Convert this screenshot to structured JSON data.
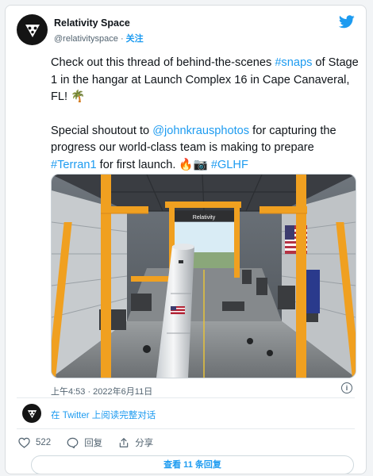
{
  "author": {
    "display_name": "Relativity Space",
    "handle": "@relativityspace",
    "separator": "·",
    "follow_label": "关注"
  },
  "tweet": {
    "para1": {
      "before": "Check out this thread of behind-the-scenes ",
      "hashtag": "#snaps",
      "after": " of Stage 1 in the hangar at Launch Complex 16 in Cape Canaveral, FL! 🌴"
    },
    "para2": {
      "before": "Special shoutout to ",
      "mention": "@johnkrausphotos",
      "middle": " for capturing the progress our world-class team is making to prepare ",
      "hashtag1": "#Terran1",
      "after": " for first launch. 🔥📷 ",
      "hashtag2": "#GLHF"
    }
  },
  "image": {
    "sign_text": "Relativity"
  },
  "timestamp": "上午4:53 · 2022年6月11日",
  "read_on_twitter": "在 Twitter 上阅读完整对话",
  "actions": {
    "like_count": "522",
    "reply_label": "回复",
    "share_label": "分享"
  },
  "view_replies": "查看 11 条回复",
  "colors": {
    "accent": "#1d9bf0",
    "text": "#0f1419",
    "muted": "#536471",
    "steel_frame": "#f0a020"
  }
}
